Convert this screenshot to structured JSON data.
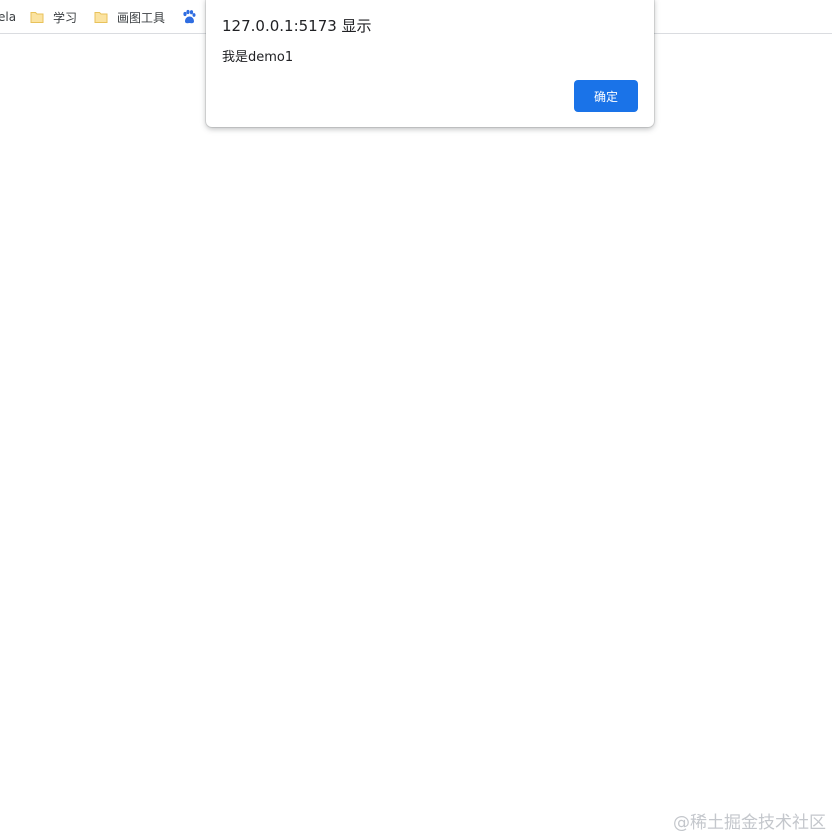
{
  "bookmarks_bar": {
    "items": [
      {
        "label": "ela",
        "icon": "none"
      },
      {
        "label": "学习",
        "icon": "folder-icon"
      },
      {
        "label": "画图工具",
        "icon": "folder-icon"
      },
      {
        "label": "",
        "icon": "baidu-paw-icon"
      }
    ]
  },
  "alert": {
    "title": "127.0.0.1:5173 显示",
    "message": "我是demo1",
    "ok_label": "确定"
  },
  "watermark": {
    "text": "@稀土掘金技术社区"
  },
  "colors": {
    "accent": "#1a73e8",
    "folder": "#f6d36a",
    "baidu_blue": "#2f6de1"
  }
}
